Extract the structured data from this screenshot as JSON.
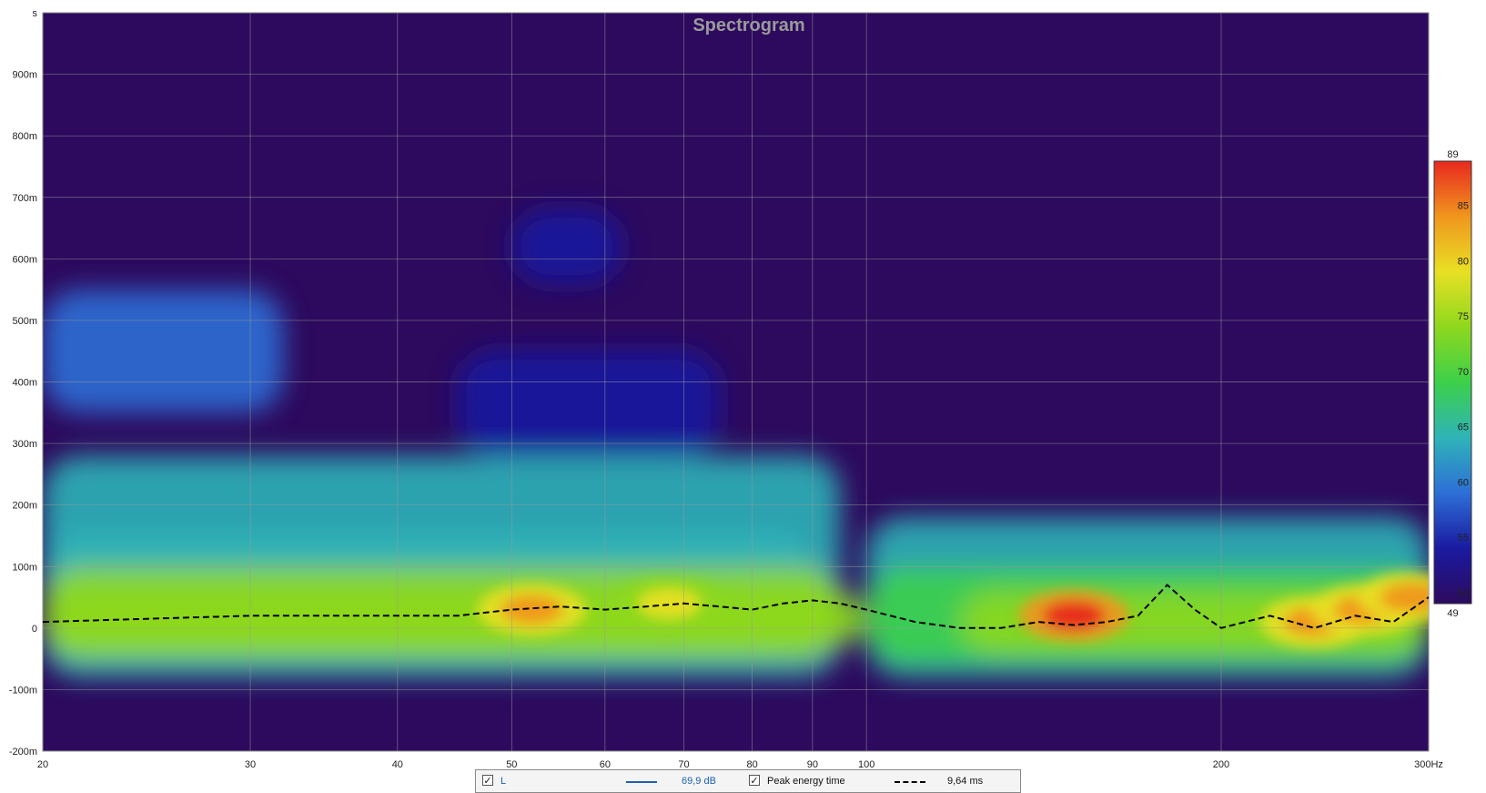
{
  "chart_data": {
    "type": "heatmap",
    "title": "Spectrogram",
    "xlabel": "",
    "ylabel": "",
    "x_unit": "Hz",
    "y_unit": "s",
    "x_scale": "log",
    "xlim": [
      20,
      300
    ],
    "ylim": [
      -0.2,
      1.0
    ],
    "x_ticks": [
      20,
      30,
      40,
      50,
      60,
      70,
      80,
      90,
      100,
      200,
      300
    ],
    "x_tick_labels": [
      "20",
      "30",
      "40",
      "50",
      "60",
      "70",
      "80",
      "90",
      "100",
      "200",
      "300Hz"
    ],
    "y_ticks": [
      -0.2,
      -0.1,
      0,
      0.1,
      0.2,
      0.3,
      0.4,
      0.5,
      0.6,
      0.7,
      0.8,
      0.9,
      1.0
    ],
    "y_tick_labels": [
      "-200m",
      "-100m",
      "0",
      "100m",
      "200m",
      "300m",
      "400m",
      "500m",
      "600m",
      "700m",
      "800m",
      "900m",
      "s"
    ],
    "colorbar": {
      "min": 49,
      "max": 89,
      "ticks": [
        49,
        50,
        55,
        60,
        65,
        70,
        75,
        80,
        85,
        89
      ],
      "colors": [
        "#2d0a5e",
        "#1a1aa0",
        "#2d6fd6",
        "#2fb3b8",
        "#3cd04a",
        "#8ed81e",
        "#e8e024",
        "#f0961e",
        "#e8281e"
      ]
    },
    "grid": true,
    "background_color": "#2d0a5e",
    "hotspots_db": [
      {
        "freq": 52,
        "time": 0.03,
        "level": 86
      },
      {
        "freq": 68,
        "time": 0.04,
        "level": 80
      },
      {
        "freq": 150,
        "time": 0.02,
        "level": 88
      },
      {
        "freq": 240,
        "time": 0.01,
        "level": 84
      },
      {
        "freq": 265,
        "time": 0.03,
        "level": 84
      },
      {
        "freq": 290,
        "time": 0.05,
        "level": 84
      }
    ],
    "peak_energy_time": {
      "freq": [
        20,
        30,
        40,
        45,
        50,
        55,
        60,
        65,
        70,
        75,
        80,
        85,
        90,
        95,
        100,
        110,
        120,
        130,
        140,
        150,
        160,
        170,
        180,
        190,
        200,
        220,
        240,
        260,
        280,
        300
      ],
      "time": [
        0.01,
        0.02,
        0.02,
        0.02,
        0.03,
        0.035,
        0.03,
        0.035,
        0.04,
        0.035,
        0.03,
        0.04,
        0.045,
        0.04,
        0.03,
        0.01,
        0.0,
        0.0,
        0.01,
        0.005,
        0.01,
        0.02,
        0.07,
        0.03,
        0.0,
        0.02,
        0.0,
        0.02,
        0.01,
        0.05
      ]
    },
    "series": [
      {
        "name": "L",
        "value": "69,9 dB",
        "color": "#1e5fb4",
        "style": "solid"
      },
      {
        "name": "Peak energy time",
        "value": "9,64 ms",
        "color": "#000000",
        "style": "dashed"
      }
    ]
  },
  "legend": {
    "items": [
      {
        "checked": "✓",
        "label": "L",
        "value": "69,9 dB"
      },
      {
        "checked": "✓",
        "label": "Peak energy time",
        "value": "9,64 ms"
      }
    ]
  }
}
